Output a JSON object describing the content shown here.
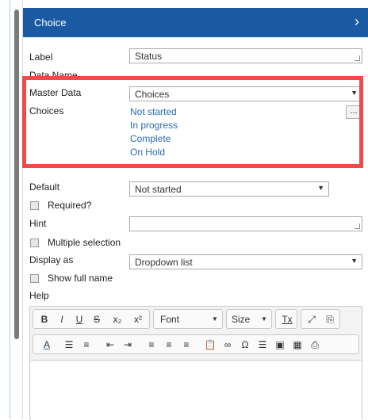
{
  "panel": {
    "title": "Choice",
    "chevron": "›"
  },
  "form": {
    "label": {
      "text": "Label",
      "value": "Status"
    },
    "data_name": {
      "text": "Data Name"
    },
    "master_data": {
      "text": "Master Data",
      "value": "Choices"
    },
    "choices": {
      "text": "Choices",
      "items": [
        "Not started",
        "In progress",
        "Complete",
        "On Hold"
      ],
      "more_label": "..."
    },
    "default": {
      "text": "Default",
      "value": "Not started"
    },
    "required": {
      "text": "Required?"
    },
    "hint": {
      "text": "Hint",
      "value": ""
    },
    "multiple_selection": {
      "text": "Multiple selection"
    },
    "display_as": {
      "text": "Display as",
      "value": "Dropdown list"
    },
    "show_full_name": {
      "text": "Show full name"
    },
    "help": {
      "text": "Help"
    }
  },
  "editor": {
    "toolbar1": {
      "bold": "B",
      "italic": "I",
      "underline": "U",
      "strike": "S",
      "subscript": "x₂",
      "superscript": "x²",
      "font": "Font",
      "size": "Size",
      "clear_format": "Tx"
    },
    "toolbar2": {
      "text_color": "A"
    }
  },
  "colors": {
    "header": "#1a5aa3",
    "link": "#2a6bb5",
    "highlight": "#f04a4a"
  }
}
